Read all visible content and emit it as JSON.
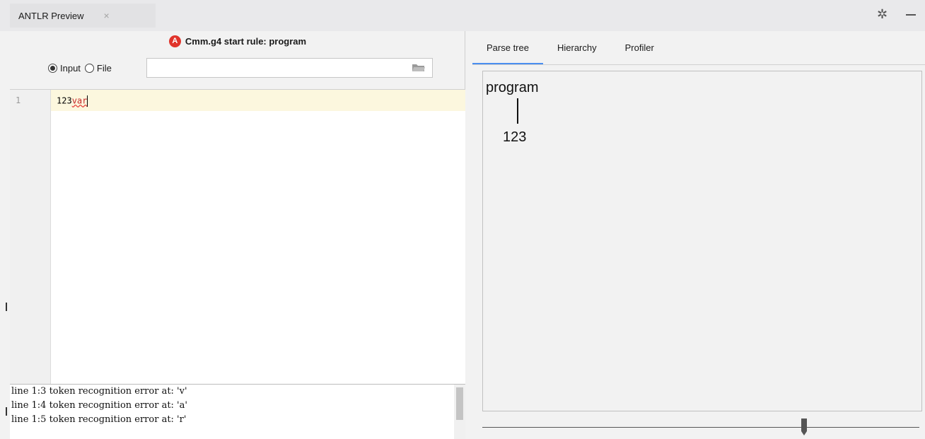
{
  "toolwindow": {
    "title": "ANTLR Preview",
    "close_glyph": "×"
  },
  "header": {
    "error_title": "Cmm.g4 start rule: program",
    "error_icon": "antlr-error-icon"
  },
  "source": {
    "input_label": "Input",
    "file_label": "File",
    "selected": "input",
    "file_path": ""
  },
  "editor": {
    "line_number": "1",
    "code_ok": "123",
    "code_error": "var"
  },
  "console": {
    "lines": [
      "line 1:3 token recognition error at: 'v'",
      "line 1:4 token recognition error at: 'a'",
      "line 1:5 token recognition error at: 'r'"
    ]
  },
  "tabs": [
    {
      "label": "Parse tree",
      "active": true
    },
    {
      "label": "Hierarchy",
      "active": false
    },
    {
      "label": "Profiler",
      "active": false
    }
  ],
  "tree": {
    "root": "program",
    "leaf": "123"
  },
  "zoom": {
    "level_fraction": 0.74
  },
  "colors": {
    "accent": "#4a8ef0",
    "error": "#e0342b"
  }
}
